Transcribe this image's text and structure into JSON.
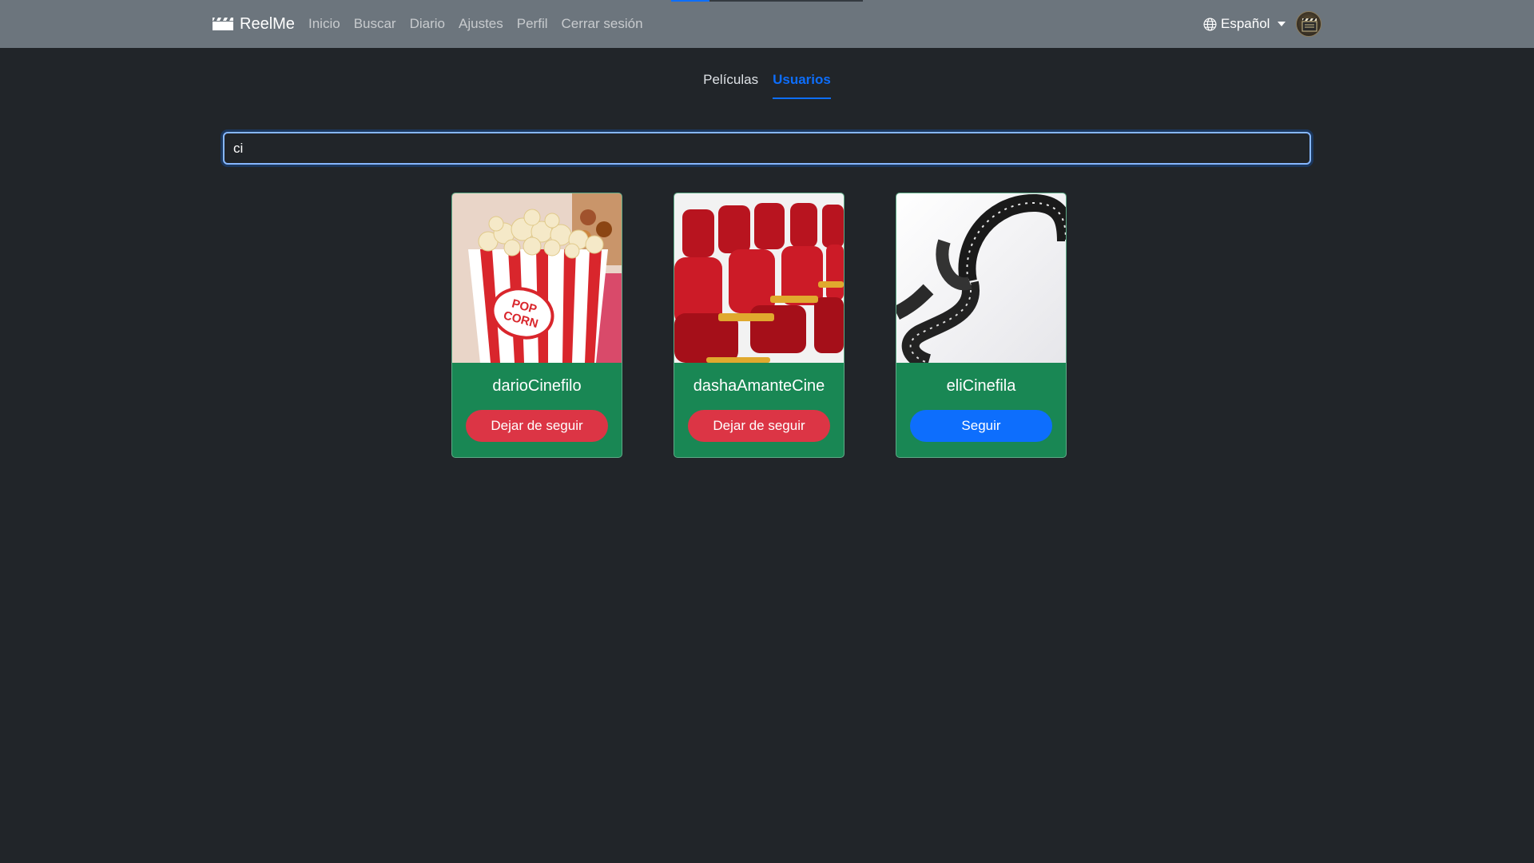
{
  "header": {
    "loading_progress": 0.2,
    "brand": "ReelMe",
    "nav": [
      "Inicio",
      "Buscar",
      "Diario",
      "Ajustes",
      "Perfil",
      "Cerrar sesión"
    ],
    "language": "Español"
  },
  "tabs": [
    {
      "label": "Películas",
      "active": false
    },
    {
      "label": "Usuarios",
      "active": true
    }
  ],
  "search": {
    "value": "ci"
  },
  "users": [
    {
      "name": "darioCinefilo",
      "button": "Dejar de seguir",
      "image": "popcorn",
      "following": true
    },
    {
      "name": "dashaAmanteCine",
      "button": "Dejar de seguir",
      "image": "cinema-seats",
      "following": true
    },
    {
      "name": "eliCinefila",
      "button": "Seguir",
      "image": "film-reel",
      "following": false
    }
  ],
  "colors": {
    "navbar": "#6c757d",
    "background": "#212529",
    "card": "#198754",
    "unfollow": "#dc3545",
    "follow": "#0d6efd",
    "active_tab": "#0d6efd"
  }
}
